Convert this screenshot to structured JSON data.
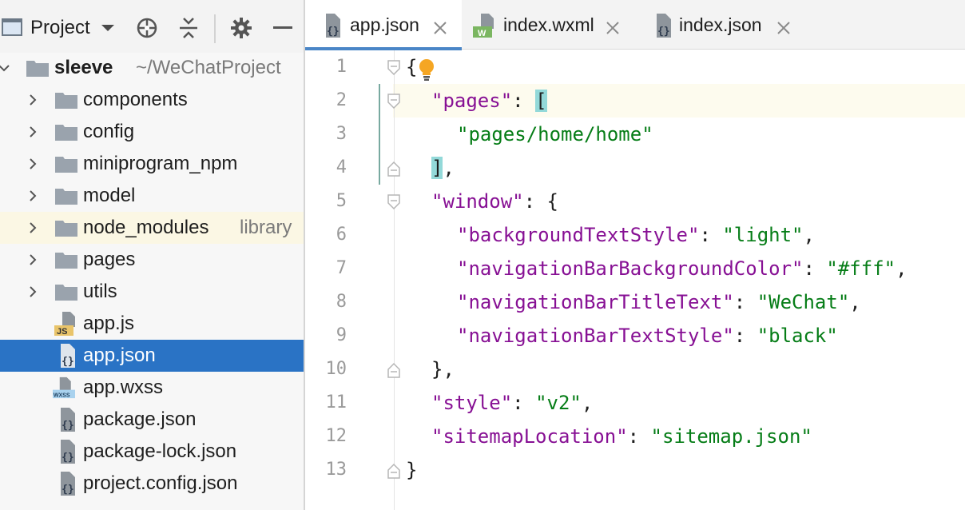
{
  "project_panel": {
    "title": "Project",
    "toolbar_icons": [
      "crosshair-icon",
      "collapse-all-icon",
      "gear-icon",
      "minimize-icon"
    ],
    "root": {
      "name": "sleeve",
      "path": "~/WeChatProject"
    },
    "items": [
      {
        "label": "components",
        "type": "folder"
      },
      {
        "label": "config",
        "type": "folder"
      },
      {
        "label": "miniprogram_npm",
        "type": "folder"
      },
      {
        "label": "model",
        "type": "folder"
      },
      {
        "label": "node_modules",
        "type": "folder",
        "suffix": "library"
      },
      {
        "label": "pages",
        "type": "folder"
      },
      {
        "label": "utils",
        "type": "folder"
      },
      {
        "label": "app.js",
        "type": "file",
        "badge": "JS"
      },
      {
        "label": "app.json",
        "type": "file",
        "selected": true
      },
      {
        "label": "app.wxss",
        "type": "file",
        "badge": "WXSS"
      },
      {
        "label": "package.json",
        "type": "file"
      },
      {
        "label": "package-lock.json",
        "type": "file"
      },
      {
        "label": "project.config.json",
        "type": "file"
      }
    ]
  },
  "tabs": [
    {
      "label": "app.json",
      "active": true,
      "icon": "json-file-icon"
    },
    {
      "label": "index.wxml",
      "active": false,
      "icon": "wxml-file-icon",
      "badge": "W"
    },
    {
      "label": "index.json",
      "active": false,
      "icon": "json-file-icon"
    }
  ],
  "editor": {
    "line_numbers": [
      "1",
      "2",
      "3",
      "4",
      "5",
      "6",
      "7",
      "8",
      "9",
      "10",
      "11",
      "12",
      "13"
    ],
    "lines": {
      "l1": {
        "p1": "{"
      },
      "l2": {
        "k": "\"pages\"",
        "p1": ": ",
        "p2": "["
      },
      "l3": {
        "s": "\"pages/home/home\""
      },
      "l4": {
        "p1": "]",
        "p2": ","
      },
      "l5": {
        "k": "\"window\"",
        "p1": ": {"
      },
      "l6": {
        "k": "\"backgroundTextStyle\"",
        "p1": ": ",
        "s": "\"light\"",
        "p2": ","
      },
      "l7": {
        "k": "\"navigationBarBackgroundColor\"",
        "p1": ": ",
        "s": "\"#fff\"",
        "p2": ","
      },
      "l8": {
        "k": "\"navigationBarTitleText\"",
        "p1": ": ",
        "s": "\"WeChat\"",
        "p2": ","
      },
      "l9": {
        "k": "\"navigationBarTextStyle\"",
        "p1": ": ",
        "s": "\"black\""
      },
      "l10": {
        "p1": "},"
      },
      "l11": {
        "k": "\"style\"",
        "p1": ": ",
        "s": "\"v2\"",
        "p2": ","
      },
      "l12": {
        "k": "\"sitemapLocation\"",
        "p1": ": ",
        "s": "\"sitemap.json\""
      },
      "l13": {
        "p1": "}"
      }
    }
  },
  "colors": {
    "selection": "#2a73c5",
    "json_key": "#871094",
    "json_string": "#067d17",
    "bracket_match": "#93d9d9",
    "caret_row": "#fdfbee"
  }
}
